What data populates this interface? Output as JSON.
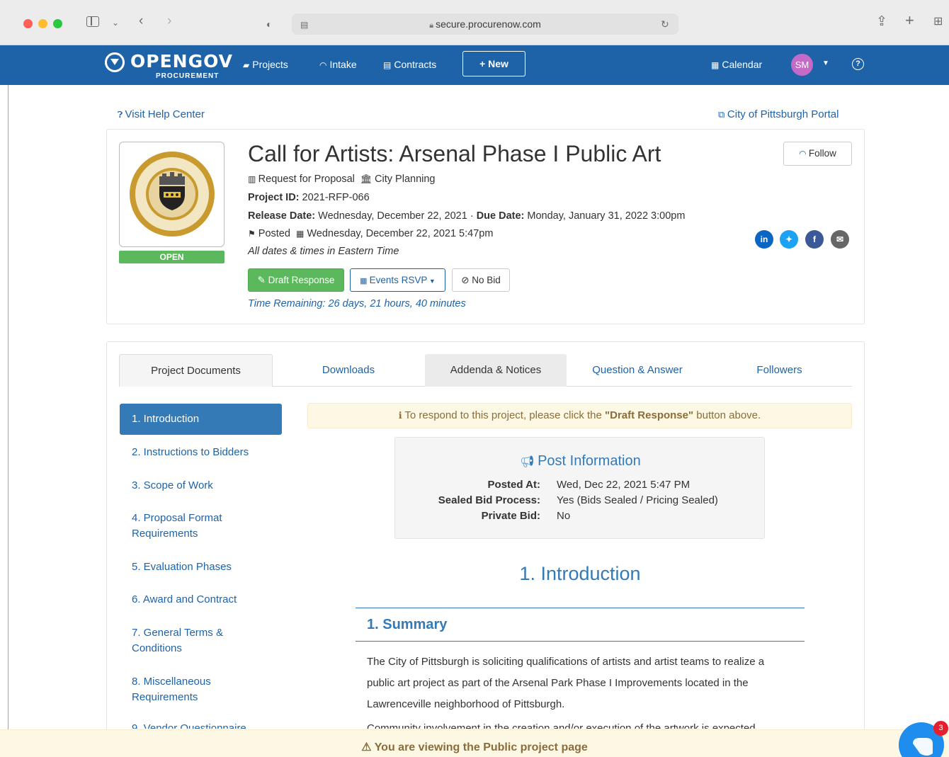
{
  "browser": {
    "url": "secure.procurenow.com"
  },
  "nav": {
    "logo_main": "OPENGOV",
    "logo_sub": "PROCUREMENT",
    "projects": "Projects",
    "intake": "Intake",
    "contracts": "Contracts",
    "new": "+ New",
    "calendar": "Calendar",
    "avatar": "SM"
  },
  "links": {
    "help": "Visit Help Center",
    "portal": "City of Pittsburgh Portal"
  },
  "project": {
    "status": "OPEN",
    "title": "Call for Artists: Arsenal Phase I Public Art",
    "type": "Request for Proposal",
    "department": "City Planning",
    "id_label": "Project ID:",
    "id_value": "2021-RFP-066",
    "release_label": "Release Date:",
    "release_value": "Wednesday, December 22, 2021",
    "due_label": "Due Date:",
    "due_value": "Monday, January 31, 2022 3:00pm",
    "posted_label": "Posted",
    "posted_value": "Wednesday, December 22, 2021 5:47pm",
    "timezone_note": "All dates & times in Eastern Time",
    "follow": "Follow",
    "draft_response": "Draft Response",
    "events_rsvp": "Events RSVP",
    "no_bid": "No Bid",
    "time_remaining": "Time Remaining: 26 days, 21 hours, 40 minutes"
  },
  "tabs": [
    "Project Documents",
    "Downloads",
    "Addenda & Notices",
    "Question & Answer",
    "Followers"
  ],
  "sections": [
    "1. Introduction",
    "2. Instructions to Bidders",
    "3. Scope of Work",
    "4. Proposal Format Requirements",
    "5. Evaluation Phases",
    "6. Award and Contract",
    "7. General Terms & Conditions",
    "8. Miscellaneous Requirements",
    "9. Vendor Questionnaire"
  ],
  "alert": {
    "before": "To respond to this project, please click the ",
    "emph": "\"Draft Response\"",
    "after": " button above."
  },
  "post_info": {
    "title": "Post Information",
    "posted_at_label": "Posted At:",
    "posted_at_value": "Wed, Dec 22, 2021 5:47 PM",
    "sealed_label": "Sealed Bid Process:",
    "sealed_value": "Yes (Bids Sealed / Pricing Sealed)",
    "private_label": "Private Bid:",
    "private_value": "No"
  },
  "content": {
    "section_title": "1. Introduction",
    "subsection_title": "1. Summary",
    "paragraph": "The City of Pittsburgh is soliciting qualifications of artists and artist teams to realize a public art project as part of the Arsenal Park Phase I Improvements located in the Lawrenceville neighborhood of Pittsburgh.",
    "paragraph2": "Community involvement in the creation and/or execution of the artwork is expected"
  },
  "footer": {
    "notice": "You are viewing the Public project page"
  },
  "chat": {
    "badge": "3"
  },
  "colors": {
    "nav_blue": "#1e63a8",
    "link_blue": "#337ab7",
    "success_green": "#5cb85c",
    "warning_bg": "#fcf8e3"
  }
}
